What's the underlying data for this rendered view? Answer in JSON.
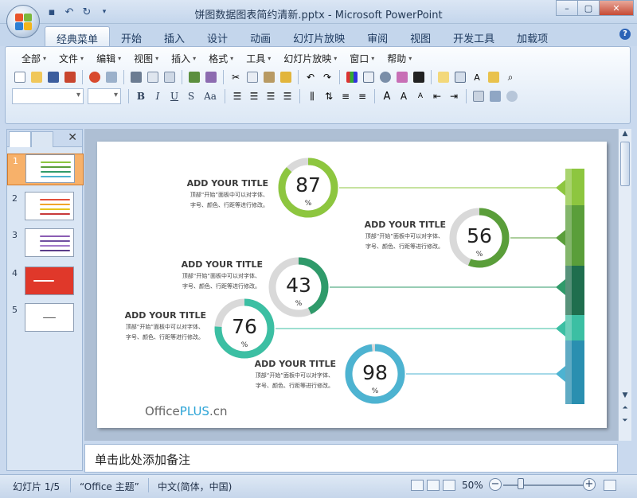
{
  "window": {
    "title": "饼图数据图表简约清新.pptx - Microsoft PowerPoint",
    "minimize_icon": "minimize-icon",
    "maximize_icon": "maximize-icon",
    "close_icon": "close-icon"
  },
  "ribbon_tabs": [
    "经典菜单",
    "开始",
    "插入",
    "设计",
    "动画",
    "幻灯片放映",
    "审阅",
    "视图",
    "开发工具",
    "加载项"
  ],
  "active_tab": "经典菜单",
  "classic_menu": [
    "全部",
    "文件",
    "编辑",
    "视图",
    "插入",
    "格式",
    "工具",
    "幻灯片放映",
    "窗口",
    "帮助"
  ],
  "format_buttons": {
    "bold": "B",
    "italic": "I",
    "underline": "U",
    "shadow": "S",
    "case": "Aa"
  },
  "slides_panel": {
    "slide_numbers": [
      "1",
      "2",
      "3",
      "4",
      "5"
    ],
    "selected": "1"
  },
  "slide": {
    "items": [
      {
        "title": "ADD YOUR TITLE",
        "desc_line1": "顶部“开始”面板中可以对字体、",
        "desc_line2": "字号、颜色、行距等进行修改。",
        "value": "87",
        "unit": "%",
        "percent": 87,
        "color": "#8dc63f",
        "side": "left"
      },
      {
        "title": "ADD YOUR TITLE",
        "desc_line1": "顶部“开始”面板中可以对字体、",
        "desc_line2": "字号、颜色、行距等进行修改。",
        "value": "56",
        "unit": "%",
        "percent": 56,
        "color": "#5a9e3a",
        "side": "left"
      },
      {
        "title": "ADD YOUR TITLE",
        "desc_line1": "顶部“开始”面板中可以对字体、",
        "desc_line2": "字号、颜色、行距等进行修改。",
        "value": "43",
        "unit": "%",
        "percent": 43,
        "color": "#2f9a6a",
        "side": "left"
      },
      {
        "title": "ADD YOUR TITLE",
        "desc_line1": "顶部“开始”面板中可以对字体、",
        "desc_line2": "字号、颜色、行距等进行修改。",
        "value": "76",
        "unit": "%",
        "percent": 76,
        "color": "#3cbfa3",
        "side": "left"
      },
      {
        "title": "ADD YOUR TITLE",
        "desc_line1": "顶部“开始”面板中可以对字体、",
        "desc_line2": "字号、颜色、行距等进行修改。",
        "value": "98",
        "unit": "%",
        "percent": 98,
        "color": "#4db3d1",
        "side": "left"
      }
    ],
    "bar_colors": [
      "#8dc63f",
      "#5a9e3a",
      "#1f6e4e",
      "#3cbfa3",
      "#2a8fb0"
    ],
    "brand_prefix": "Office",
    "brand_highlight": "PLUS",
    "brand_suffix": ".cn"
  },
  "notes_placeholder": "单击此处添加备注",
  "status": {
    "slide_counter": "幻灯片 1/5",
    "theme": "“Office 主题”",
    "language": "中文(简体，中国)",
    "zoom": "50%"
  }
}
